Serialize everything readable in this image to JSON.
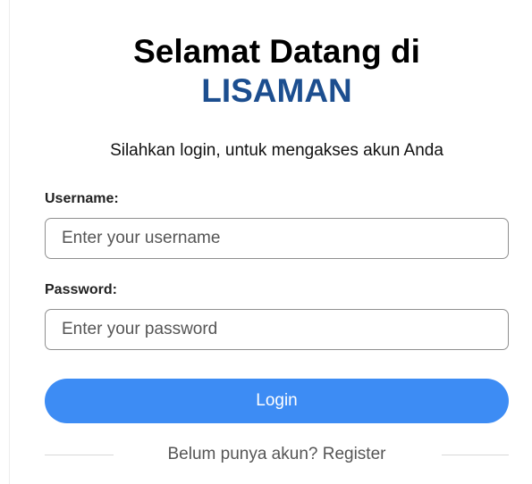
{
  "header": {
    "title_line1": "Selamat Datang di",
    "title_brand": "LISAMAN",
    "subtitle": "Silahkan login, untuk mengakses akun Anda"
  },
  "form": {
    "username_label": "Username:",
    "username_placeholder": "Enter your username",
    "password_label": "Password:",
    "password_placeholder": "Enter your password",
    "login_label": "Login"
  },
  "footer": {
    "register_prompt": "Belum punya akun?",
    "register_link": "Register"
  },
  "colors": {
    "brand": "#1c4e8f",
    "button": "#3d8cf4"
  }
}
